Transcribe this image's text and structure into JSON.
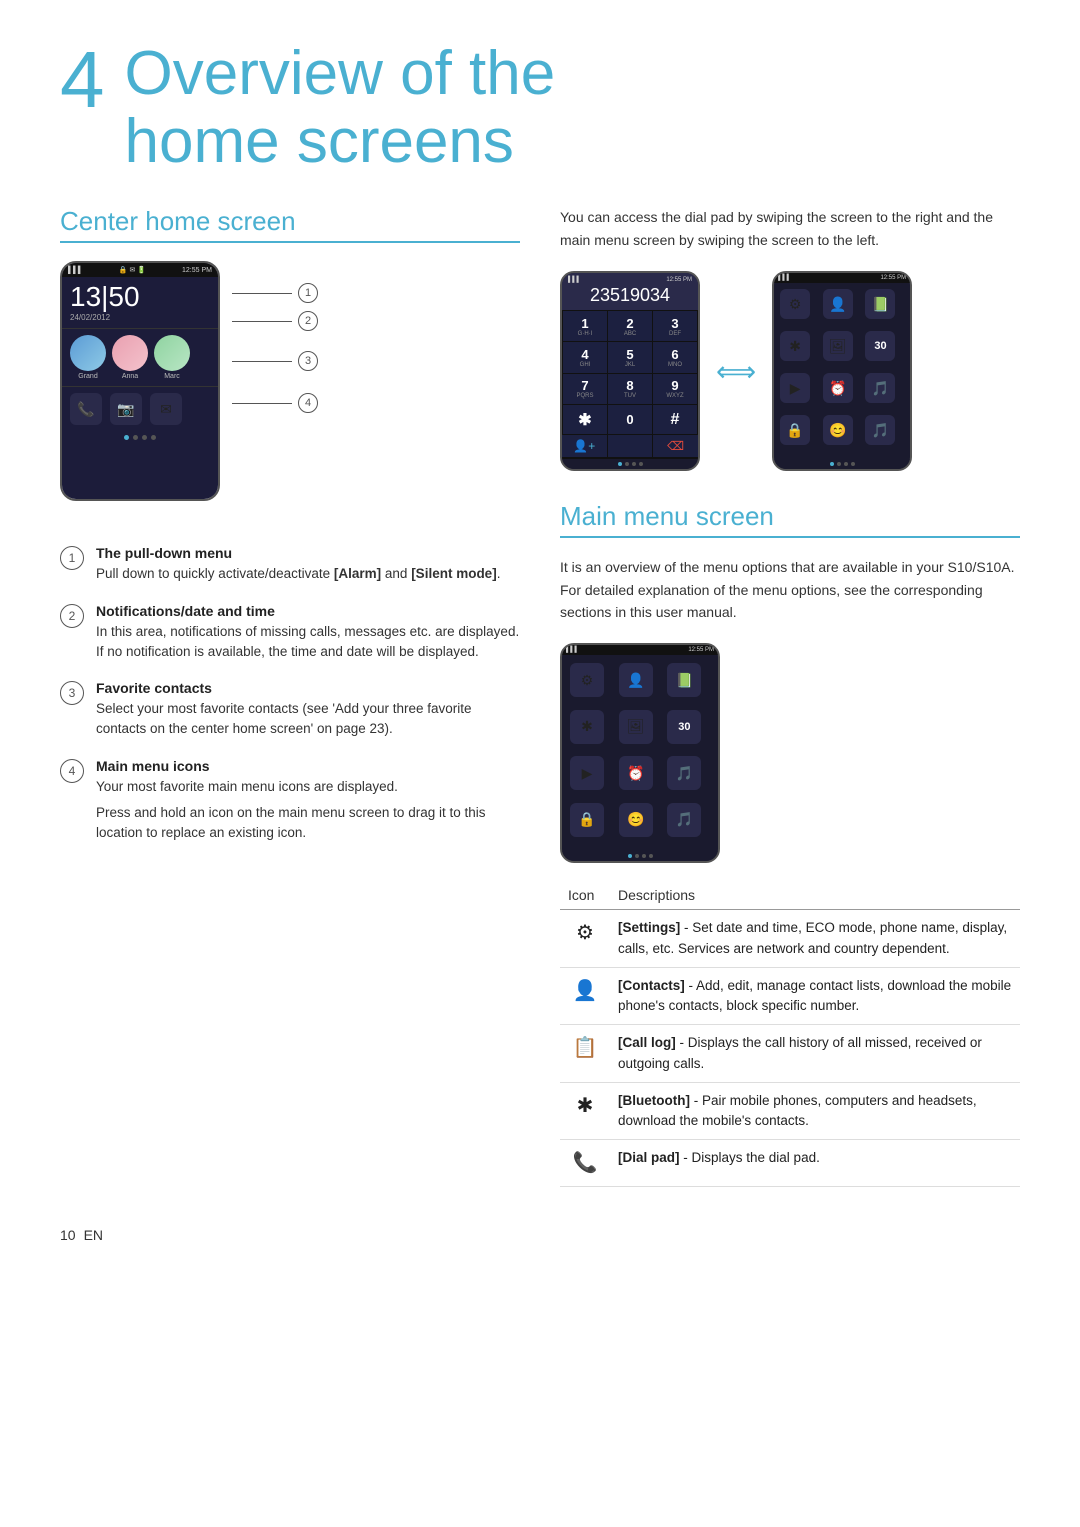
{
  "page": {
    "number": "10",
    "lang": "EN"
  },
  "title": {
    "number": "4",
    "text_line1": "Overview of the",
    "text_line2": "home screens"
  },
  "center_home": {
    "heading": "Center home screen",
    "phone": {
      "status": "12:55 PM",
      "clock": "13|50",
      "date": "24/02/2012",
      "contacts": [
        "Grand",
        "Anna",
        "Marc"
      ],
      "dots": [
        true,
        false,
        false,
        false
      ]
    },
    "callouts": [
      {
        "num": "1",
        "offset_pct": 18
      },
      {
        "num": "2",
        "offset_pct": 30
      },
      {
        "num": "3",
        "offset_pct": 60
      },
      {
        "num": "4",
        "offset_pct": 82
      }
    ],
    "items": [
      {
        "num": "1",
        "title": "The pull-down menu",
        "desc": "Pull down to quickly activate/deactivate [Alarm] and [Silent mode]."
      },
      {
        "num": "2",
        "title": "Notifications/date and time",
        "desc": "In this area, notifications of missing calls, messages etc. are displayed. If no notification is available, the time and date will be displayed."
      },
      {
        "num": "3",
        "title": "Favorite contacts",
        "desc": "Select your most favorite contacts (see 'Add your three favorite contacts on the center home screen' on page 23)."
      },
      {
        "num": "4",
        "title": "Main menu icons",
        "desc1": "Your most favorite main menu icons are displayed.",
        "desc2": "Press and hold an icon on the main menu screen to drag it to this location to replace an existing icon."
      }
    ]
  },
  "right_col": {
    "intro": "You can access the dial pad by swiping the screen to the right and the main menu screen by swiping the screen to the left.",
    "dial_phone": {
      "status": "12:55 PM",
      "number_display": "23519034",
      "keys": [
        {
          "num": "1",
          "letters": "GHI"
        },
        {
          "num": "2",
          "letters": "ABC"
        },
        {
          "num": "3",
          "letters": "DEF"
        },
        {
          "num": "4",
          "letters": "GHI"
        },
        {
          "num": "5",
          "letters": "JKL"
        },
        {
          "num": "6",
          "letters": "MNO"
        },
        {
          "num": "7",
          "letters": "PQRS"
        },
        {
          "num": "8",
          "letters": "TUV"
        },
        {
          "num": "9",
          "letters": "WXYZ"
        },
        {
          "num": "*",
          "letters": ""
        },
        {
          "num": "0",
          "letters": ""
        },
        {
          "num": "#",
          "letters": ""
        }
      ],
      "bottom_keys": [
        "person+",
        "",
        "backspace"
      ],
      "dots": [
        true,
        false,
        false,
        false
      ]
    },
    "menu_phone": {
      "status": "12:55 PM",
      "icons": [
        "⚙",
        "👤",
        "📋",
        "✱",
        "🖼",
        "30",
        "▶",
        "⏰",
        "🎵",
        "🔒",
        "😊",
        "🎵"
      ],
      "dots": [
        true,
        false,
        false,
        false
      ]
    }
  },
  "main_menu": {
    "heading": "Main menu screen",
    "intro": "It is an overview of the menu options that are available in your S10/S10A. For detailed explanation of the menu options, see the corresponding sections in this user manual.",
    "table_header_icon": "Icon",
    "table_header_desc": "Descriptions",
    "rows": [
      {
        "icon": "⚙",
        "label": "[Settings]",
        "desc": " - Set date and time, ECO mode, phone name, display, calls, etc. Services are network and country dependent."
      },
      {
        "icon": "👤",
        "label": "[Contacts]",
        "desc": " - Add, edit, manage contact lists, download the mobile phone's contacts, block specific number."
      },
      {
        "icon": "📋",
        "label": "[Call log]",
        "desc": " - Displays the call history of all missed, received or outgoing calls."
      },
      {
        "icon": "✱",
        "label": "[Bluetooth]",
        "desc": " - Pair mobile phones, computers and headsets, download the mobile's contacts."
      },
      {
        "icon": "📞",
        "label": "[Dial pad]",
        "desc": " - Displays the dial pad."
      }
    ]
  }
}
